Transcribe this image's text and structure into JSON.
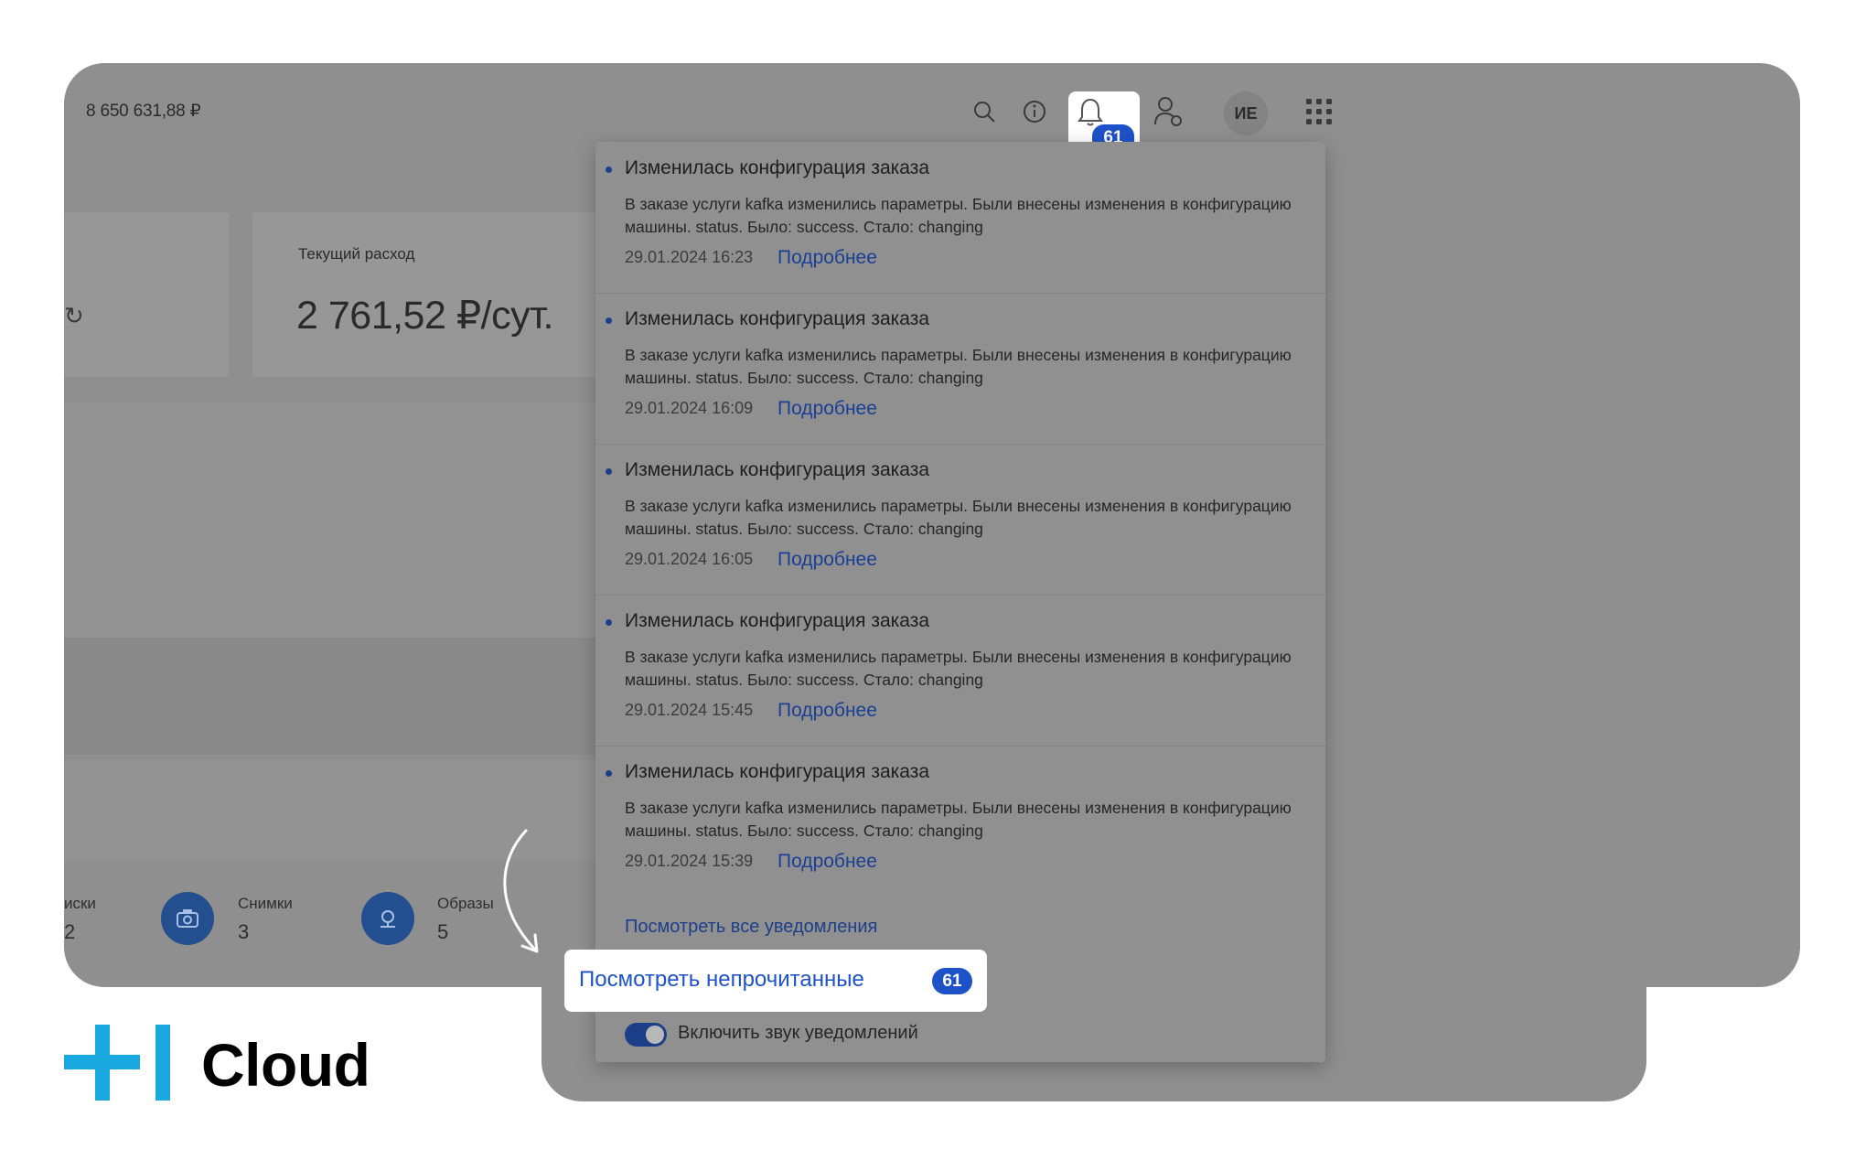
{
  "header": {
    "balance": "8 650 631,88 ₽",
    "avatar_initials": "ИЕ",
    "notification_count": "61",
    "icons": [
      "search-icon",
      "info-icon",
      "bell-icon",
      "user-settings-icon",
      "apps-grid-icon"
    ]
  },
  "dashboard": {
    "spend_label": "Текущий расход",
    "spend_value": "2 761,52 ₽/сут.",
    "stats": [
      {
        "label": "иски",
        "value": "2",
        "icon": "disk-icon"
      },
      {
        "label": "Снимки",
        "value": "3",
        "icon": "camera-icon"
      },
      {
        "label": "Образы",
        "value": "5",
        "icon": "image-icon"
      }
    ]
  },
  "notifications": {
    "items": [
      {
        "title": "Изменилась конфигурация заказа",
        "body": "В заказе услуги kafka изменились параметры. Были внесены изменения в конфигурацию машины. status. Было: success. Стало: changing",
        "time": "29.01.2024 16:23",
        "link": "Подробнее"
      },
      {
        "title": "Изменилась конфигурация заказа",
        "body": "В заказе услуги kafka изменились параметры. Были внесены изменения в конфигурацию машины. status. Было: success. Стало: changing",
        "time": "29.01.2024 16:09",
        "link": "Подробнее"
      },
      {
        "title": "Изменилась конфигурация заказа",
        "body": "В заказе услуги kafka изменились параметры. Были внесены изменения в конфигурацию машины. status. Было: success. Стало: changing",
        "time": "29.01.2024 16:05",
        "link": "Подробнее"
      },
      {
        "title": "Изменилась конфигурация заказа",
        "body": "В заказе услуги kafka изменились параметры. Были внесены изменения в конфигурацию машины. status. Было: success. Стало: changing",
        "time": "29.01.2024 15:45",
        "link": "Подробнее"
      },
      {
        "title": "Изменилась конфигурация заказа",
        "body": "В заказе услуги kafka изменились параметры. Были внесены изменения в конфигурацию машины. status. Было: success. Стало: changing",
        "time": "29.01.2024 15:39",
        "link": "Подробнее"
      }
    ],
    "view_all": "Посмотреть все уведомления",
    "view_unread": "Посмотреть непрочитанные",
    "unread_count": "61",
    "sound_toggle_label": "Включить звук уведомлений",
    "sound_enabled": true
  },
  "brand": {
    "name": "Cloud",
    "accent_color": "#1aa8e0"
  },
  "colors": {
    "primary_blue": "#1d52c8",
    "overlay_grey": "#8f8f8f"
  }
}
